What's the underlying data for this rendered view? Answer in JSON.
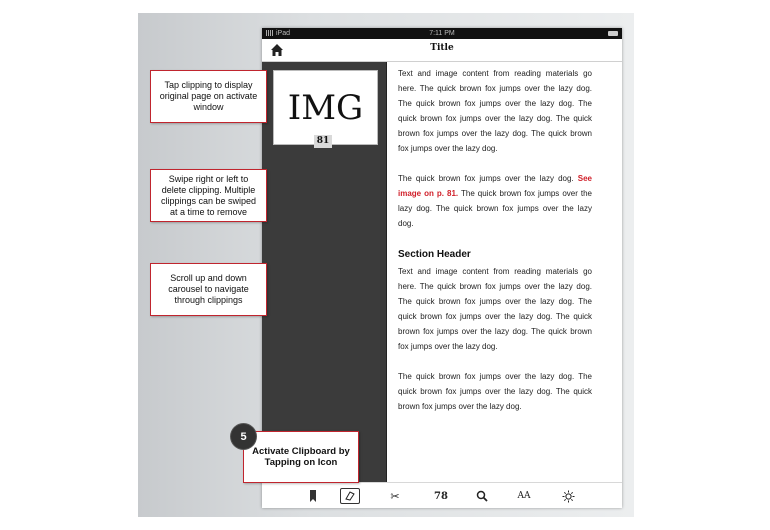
{
  "status": {
    "carrier": "iPad",
    "time": "7:11 PM"
  },
  "navbar": {
    "title": "Title"
  },
  "clipping": {
    "label": "IMG",
    "page": "81"
  },
  "reader": {
    "para1": "Text and image content from reading materials go here. The quick brown fox jumps over the lazy dog. The quick brown fox jumps over the lazy dog. The quick brown fox jumps over the lazy dog. The quick brown fox jumps over the lazy dog. The quick brown fox jumps over the lazy dog.",
    "para2_start": "The quick brown fox jumps over the lazy dog. ",
    "para2_link": "See image on p. 81.",
    "para2_end": " The quick brown fox jumps over the lazy dog. The quick brown fox jumps over the lazy dog.",
    "section_header": "Section Header",
    "para3": "Text and image content from reading materials go here. The quick brown fox jumps over the lazy dog. The quick brown fox jumps over the lazy dog. The quick brown fox jumps over the lazy dog. The quick brown fox jumps over the lazy dog. The quick brown fox jumps over the lazy dog.",
    "para4": "The quick brown fox jumps over the lazy dog. The quick brown fox jumps over the lazy dog. The quick brown fox jumps over the lazy dog."
  },
  "toolbar": {
    "page_label": "78",
    "font_label": "AA"
  },
  "annotations": {
    "tap_clipping": "Tap clipping to display original page on activate window",
    "swipe": "Swipe right or left to delete clipping. Multiple clippings can be swiped at a time to remove",
    "scroll": "Scroll up and down carousel to navigate through clippings",
    "activate": "Activate Clipboard by Tapping on Icon",
    "step_number": "5"
  },
  "colors": {
    "accent": "#c0252e",
    "link": "#d0202a",
    "panel": "#3b3b3b"
  },
  "icons": [
    "home-icon",
    "bookmark-icon",
    "clipboard-icon",
    "scissors-icon",
    "search-icon",
    "font-size-icon",
    "brightness-icon"
  ]
}
